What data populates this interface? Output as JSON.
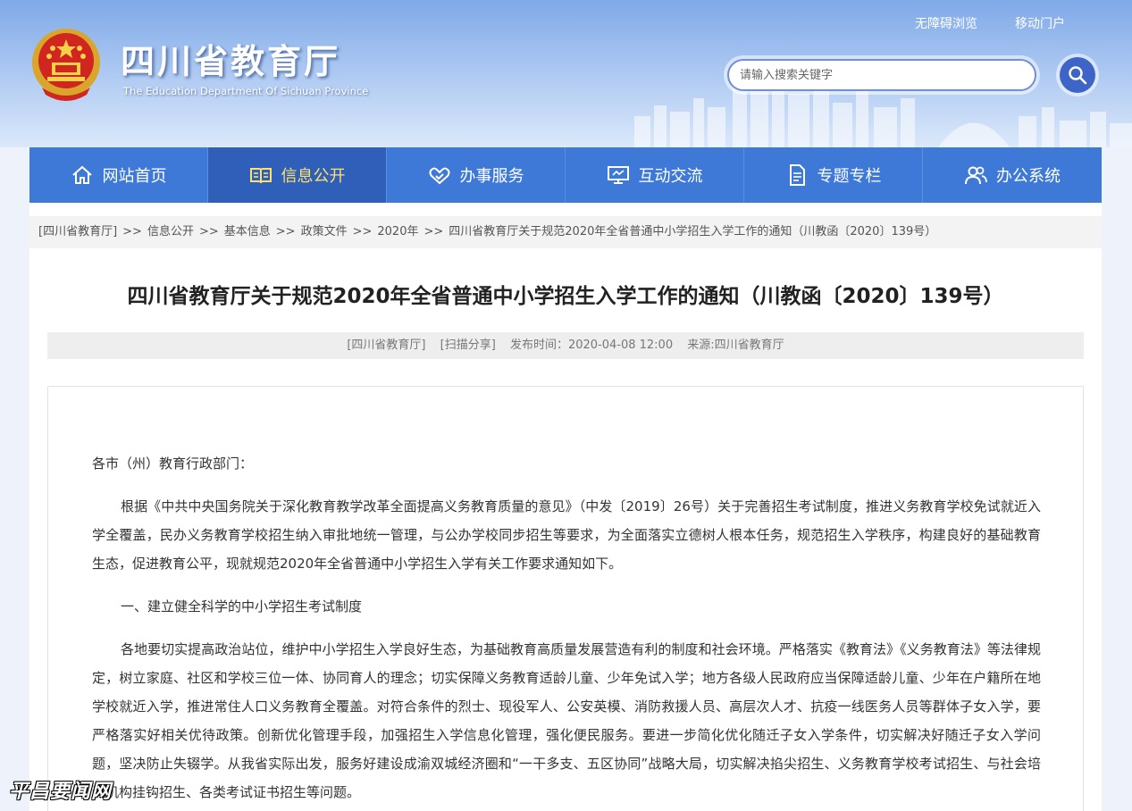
{
  "header": {
    "title": "四川省教育厅",
    "subtitle": "The Education Department Of Sichuan Province",
    "top_links": [
      "无障碍浏览",
      "移动门户"
    ],
    "search": {
      "placeholder": "请输入搜索关键字"
    }
  },
  "nav": {
    "items": [
      {
        "label": "网站首页",
        "icon": "home-icon"
      },
      {
        "label": "信息公开",
        "icon": "book-icon"
      },
      {
        "label": "办事服务",
        "icon": "handshake-icon"
      },
      {
        "label": "互动交流",
        "icon": "monitor-icon"
      },
      {
        "label": "专题专栏",
        "icon": "document-icon"
      },
      {
        "label": "办公系统",
        "icon": "users-icon"
      }
    ],
    "active_index": 1
  },
  "breadcrumb": {
    "items": [
      "[四川省教育厅]",
      "信息公开",
      "基本信息",
      "政策文件",
      "2020年",
      "四川省教育厅关于规范2020年全省普通中小学招生入学工作的通知（川教函〔2020〕139号）"
    ],
    "separator": ">>"
  },
  "article": {
    "title": "四川省教育厅关于规范2020年全省普通中小学招生入学工作的通知（川教函〔2020〕139号）",
    "meta": {
      "source_tag": "[四川省教育厅]",
      "share": "[扫描分享]",
      "publish_time": "发布时间：2020-04-08 12:00",
      "origin": "来源:四川省教育厅"
    },
    "salutation": "各市（州）教育行政部门：",
    "paragraphs": [
      "根据《中共中央国务院关于深化教育教学改革全面提高义务教育质量的意见》（中发〔2019〕26号）关于完善招生考试制度，推进义务教育学校免试就近入学全覆盖，民办义务教育学校招生纳入审批地统一管理，与公办学校同步招生等要求，为全面落实立德树人根本任务，规范招生入学秩序，构建良好的基础教育生态，促进教育公平，现就规范2020年全省普通中小学招生入学有关工作要求通知如下。",
      "一、建立健全科学的中小学招生考试制度",
      "各地要切实提高政治站位，维护中小学招生入学良好生态，为基础教育高质量发展营造有利的制度和社会环境。严格落实《教育法》《义务教育法》等法律规定，树立家庭、社区和学校三位一体、协同育人的理念；切实保障义务教育适龄儿童、少年免试入学；地方各级人民政府应当保障适龄儿童、少年在户籍所在地学校就近入学，推进常住人口义务教育全覆盖。对符合条件的烈士、现役军人、公安英模、消防救援人员、高层次人才、抗疫一线医务人员等群体子女入学，要严格落实好相关优待政策。创新优化管理手段，加强招生入学信息化管理，强化便民服务。要进一步简化优化随迁子女入学条件，切实解决好随迁子女入学问题，坚决防止失辍学。从我省实际出发，服务好建设成渝双城经济圈和“一干多支、五区协同”战略大局，切实解决掐尖招生、义务教育学校考试招生、与社会培训机构挂钩招生、各类考试证书招生等问题。"
    ]
  },
  "watermark": "平昌要闻网",
  "colors": {
    "nav_bg": "#3e79d8",
    "nav_active_bg": "#2f5fb8",
    "nav_active_text": "#ffe16a",
    "search_border": "#6f8fd6",
    "search_button": "#3d64c6"
  }
}
